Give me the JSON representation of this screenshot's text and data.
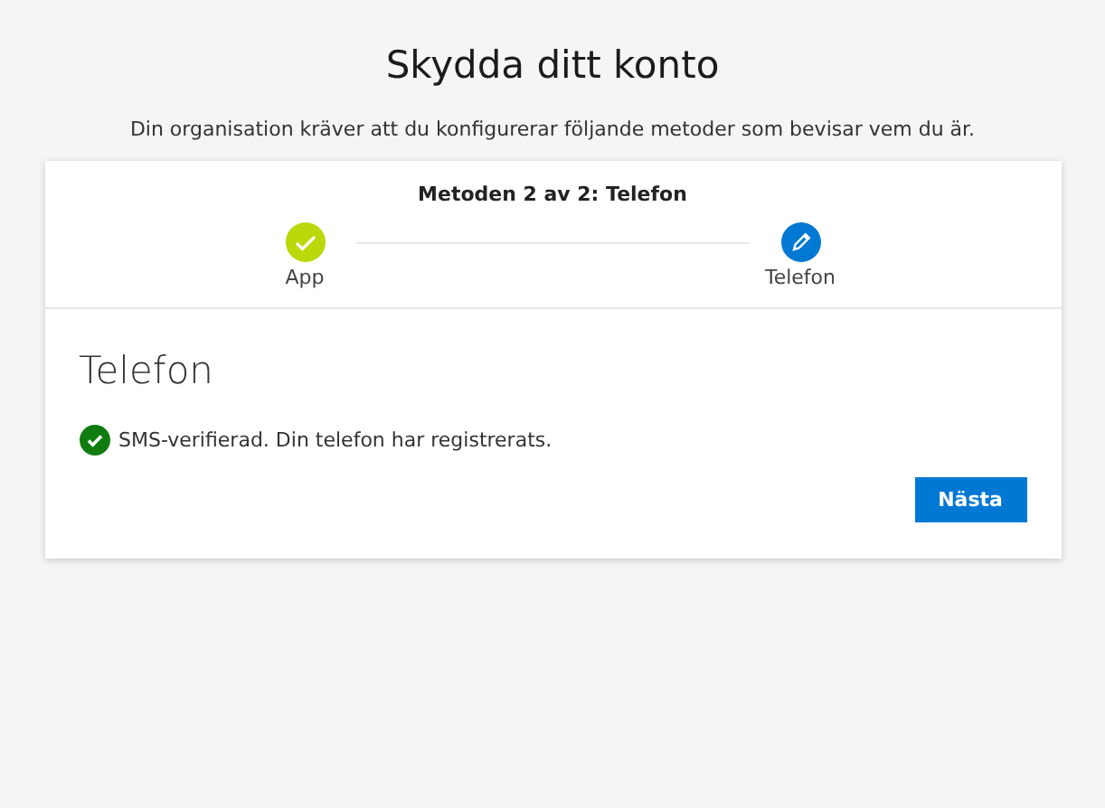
{
  "title": "Skydda ditt konto",
  "subtitle": "Din organisation kräver att du konfigurerar följande metoder som bevisar vem du är.",
  "progress": {
    "caption": "Metoden 2 av 2: Telefon",
    "steps": [
      {
        "label": "App",
        "kind": "done"
      },
      {
        "label": "Telefon",
        "kind": "current"
      }
    ]
  },
  "section": {
    "heading": "Telefon",
    "message": "SMS-verifierad. Din telefon har registrerats.",
    "verified": true
  },
  "buttons": [
    {
      "label": "Nästa"
    }
  ]
}
